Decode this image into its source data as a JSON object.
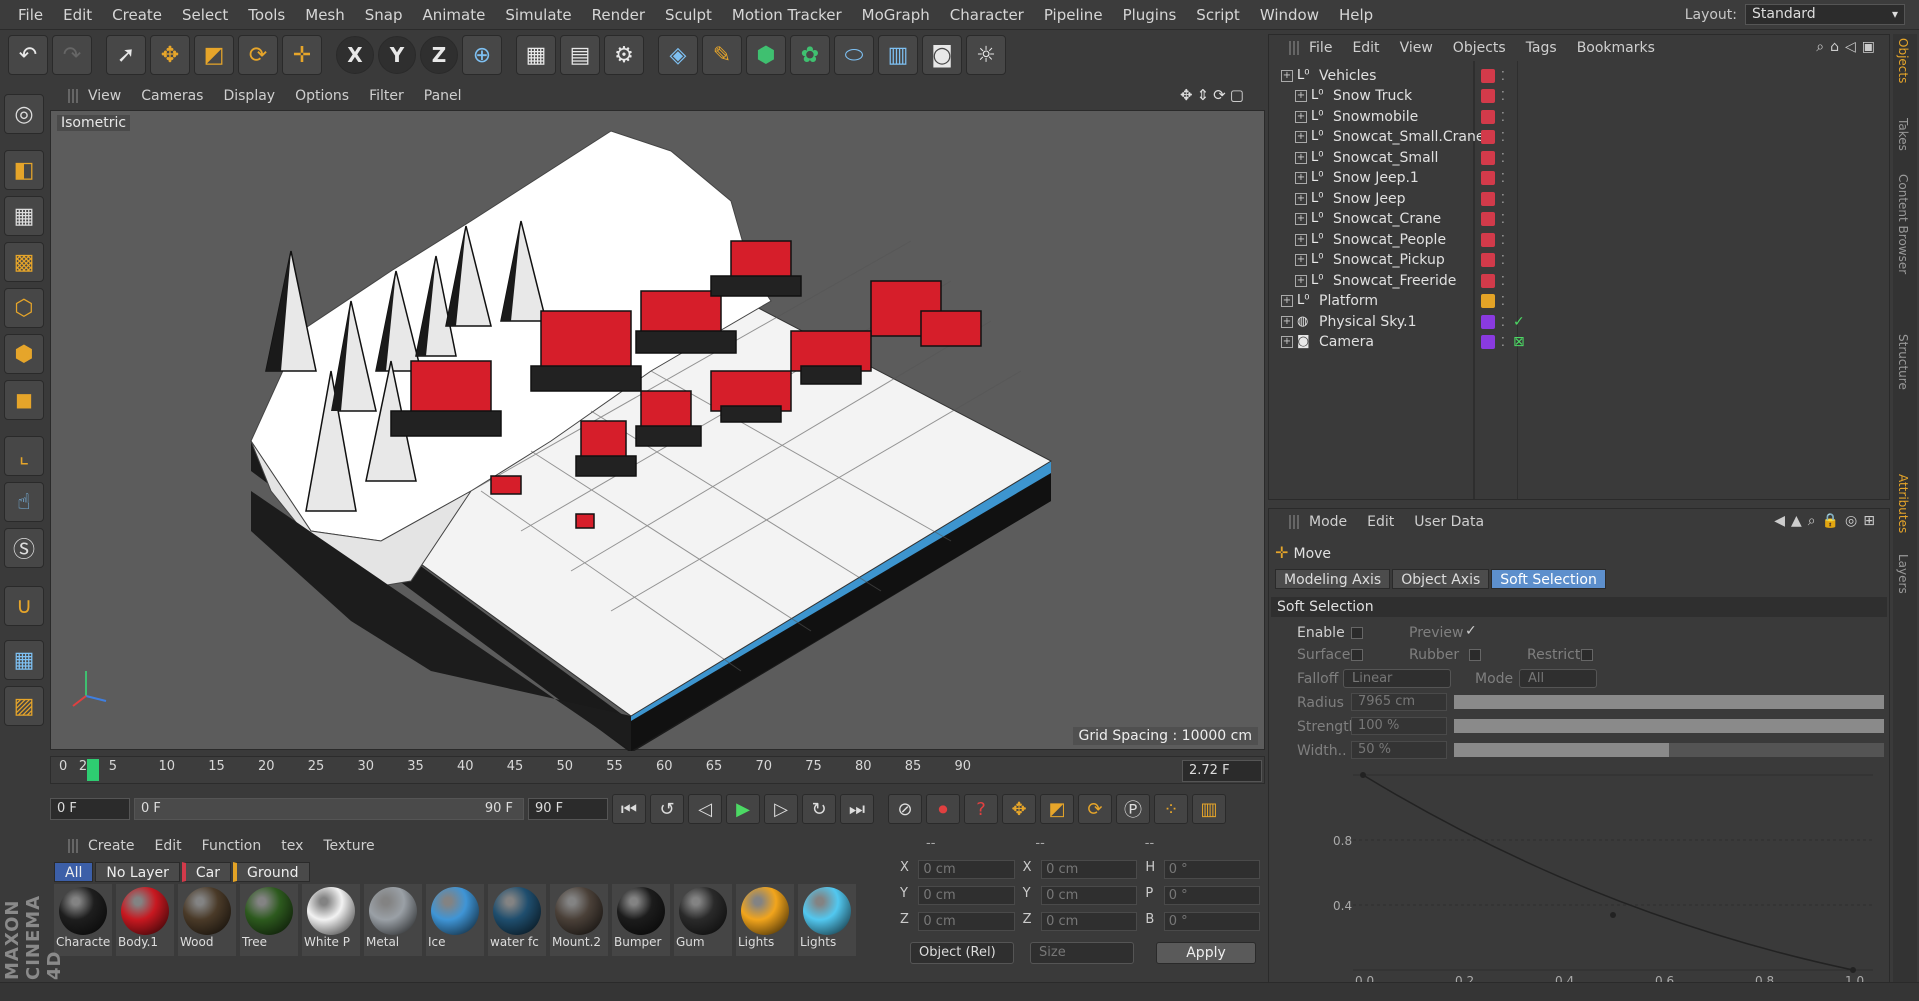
{
  "menubar": {
    "items": [
      "File",
      "Edit",
      "Create",
      "Select",
      "Tools",
      "Mesh",
      "Snap",
      "Animate",
      "Simulate",
      "Render",
      "Sculpt",
      "Motion Tracker",
      "MoGraph",
      "Character",
      "Pipeline",
      "Plugins",
      "Script",
      "Window",
      "Help"
    ],
    "layout_label": "Layout:",
    "layout_value": "Standard"
  },
  "viewport": {
    "menu": [
      "View",
      "Cameras",
      "Display",
      "Options",
      "Filter",
      "Panel"
    ],
    "view_name": "Isometric",
    "grid_spacing": "Grid Spacing : 10000 cm"
  },
  "timeline": {
    "ticks": [
      "0",
      "2",
      "5",
      "10",
      "15",
      "20",
      "25",
      "30",
      "35",
      "40",
      "45",
      "50",
      "55",
      "60",
      "65",
      "70",
      "75",
      "80",
      "85",
      "90"
    ],
    "current": "2.72 F"
  },
  "transport": {
    "start": "0 F",
    "range_start": "0 F",
    "range_end": "90 F",
    "end": "90 F"
  },
  "material_manager": {
    "menu": [
      "Create",
      "Edit",
      "Function",
      "tex",
      "Texture"
    ],
    "filters": [
      "All",
      "No Layer",
      "Car",
      "Ground"
    ],
    "materials": [
      {
        "name": "Characte",
        "color": "#1e1e1e"
      },
      {
        "name": "Body.1",
        "color": "#c81820"
      },
      {
        "name": "Wood",
        "color": "#4a3a28"
      },
      {
        "name": "Tree",
        "color": "#2d5a1e"
      },
      {
        "name": "White P",
        "color": "#f2f2f2"
      },
      {
        "name": "Metal",
        "color": "#9aa0a6"
      },
      {
        "name": "Ice",
        "color": "#3f95d6"
      },
      {
        "name": "water fc",
        "color": "#1f4e6e"
      },
      {
        "name": "Mount.2",
        "color": "#4a4038"
      },
      {
        "name": "Bumper",
        "color": "#1c1c1c"
      },
      {
        "name": "Gum",
        "color": "#2a2a2a"
      },
      {
        "name": "Lights",
        "color": "#f2a51c"
      },
      {
        "name": "Lights",
        "color": "#52c8f0"
      }
    ]
  },
  "coordinates": {
    "header": [
      "--",
      "--",
      "--"
    ],
    "rows": [
      {
        "a": "X",
        "av": "0 cm",
        "b": "X",
        "bv": "0 cm",
        "c": "H",
        "cv": "0 °"
      },
      {
        "a": "Y",
        "av": "0 cm",
        "b": "Y",
        "bv": "0 cm",
        "c": "P",
        "cv": "0 °"
      },
      {
        "a": "Z",
        "av": "0 cm",
        "b": "Z",
        "bv": "0 cm",
        "c": "B",
        "cv": "0 °"
      }
    ],
    "mode": "Object (Rel)",
    "size": "Size",
    "apply": "Apply"
  },
  "object_manager": {
    "menu": [
      "File",
      "Edit",
      "View",
      "Objects",
      "Tags",
      "Bookmarks"
    ],
    "objects": [
      {
        "name": "Vehicles",
        "indent": 0,
        "tag": "#d23a4a"
      },
      {
        "name": "Snow Truck",
        "indent": 1,
        "tag": "#d23a4a"
      },
      {
        "name": "Snowmobile",
        "indent": 1,
        "tag": "#d23a4a"
      },
      {
        "name": "Snowcat_Small.Crane",
        "indent": 1,
        "tag": "#d23a4a"
      },
      {
        "name": "Snowcat_Small",
        "indent": 1,
        "tag": "#d23a4a"
      },
      {
        "name": "Snow Jeep.1",
        "indent": 1,
        "tag": "#d23a4a"
      },
      {
        "name": "Snow Jeep",
        "indent": 1,
        "tag": "#d23a4a"
      },
      {
        "name": "Snowcat_Crane",
        "indent": 1,
        "tag": "#d23a4a"
      },
      {
        "name": "Snowcat_People",
        "indent": 1,
        "tag": "#d23a4a"
      },
      {
        "name": "Snowcat_Pickup",
        "indent": 1,
        "tag": "#d23a4a"
      },
      {
        "name": "Snowcat_Freeride",
        "indent": 1,
        "tag": "#d23a4a"
      },
      {
        "name": "Platform",
        "indent": 0,
        "tag": "#e3a326"
      },
      {
        "name": "Physical Sky.1",
        "indent": 0,
        "tag": "#8a3ae0"
      },
      {
        "name": "Camera",
        "indent": 0,
        "tag": "#8a3ae0"
      }
    ]
  },
  "side_tabs": [
    "Objects",
    "Takes",
    "Content Browser",
    "Structure",
    "Attributes",
    "Layers"
  ],
  "attributes": {
    "menu": [
      "Mode",
      "Edit",
      "User Data"
    ],
    "tool": "Move",
    "tabs": [
      "Modeling Axis",
      "Object Axis",
      "Soft Selection"
    ],
    "section": "Soft Selection",
    "enable": "Enable",
    "preview": "Preview",
    "surface": "Surface",
    "rubber": "Rubber",
    "restrict": "Restrict",
    "falloff_label": "Falloff",
    "falloff_value": "Linear",
    "mode_label": "Mode",
    "mode_value": "All",
    "radius_label": "Radius",
    "radius_value": "7965 cm",
    "radius_fraction": 1.0,
    "strength_label": "Strength",
    "strength_value": "100 %",
    "strength_fraction": 1.0,
    "width_label": "Width..",
    "width_value": "50 %",
    "width_fraction": 0.5,
    "graph": {
      "y_ticks": [
        "0.8",
        "0.4"
      ],
      "x_ticks": [
        "0.0",
        "0.2",
        "0.4",
        "0.6",
        "0.8",
        "1.0"
      ]
    }
  },
  "brand": "MAXON CINEMA 4D"
}
